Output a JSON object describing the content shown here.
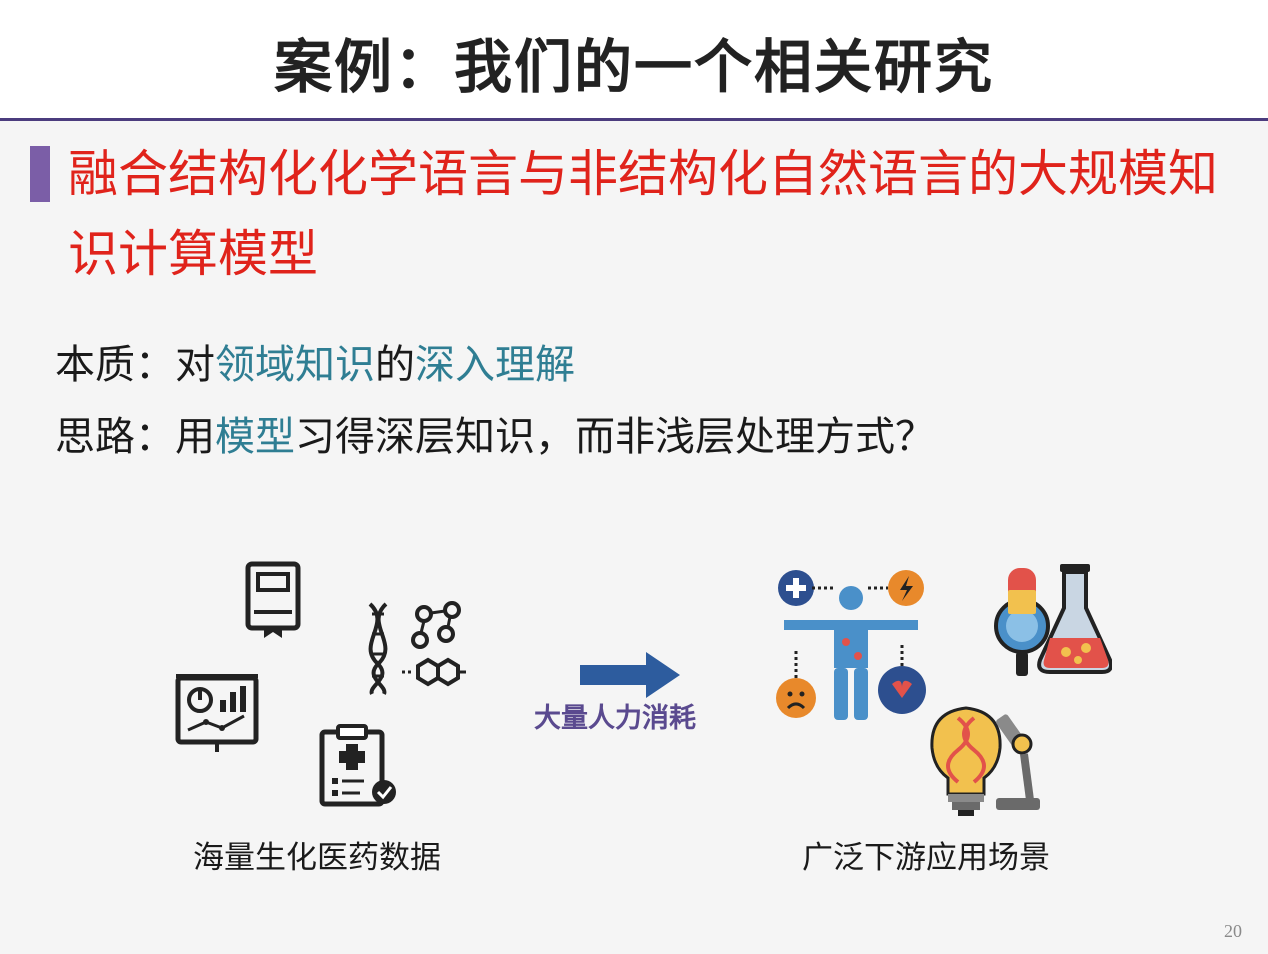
{
  "slide": {
    "title": "案例：我们的一个相关研究",
    "headline": "融合结构化化学语言与非结构化自然语言的大规模知识计算模型",
    "line1": {
      "prefix": "本质：对",
      "hl1": "领域知识",
      "mid": "的",
      "hl2": "深入理解"
    },
    "line2": {
      "prefix": "思路：用",
      "hl1": "模型",
      "rest": "习得深层知识，而非浅层处理方式？"
    },
    "left_caption": "海量生化医药数据",
    "arrow_label": "大量人力消耗",
    "right_caption": "广泛下游应用场景",
    "page_number": "20"
  },
  "colors": {
    "title_rule": "#4b3c7e",
    "accent_bar": "#7b5ea7",
    "headline": "#e0231b",
    "highlight": "#2f7e93",
    "arrow": "#2d5c9e"
  },
  "icons": [
    "book-icon",
    "dna-molecule-icon",
    "dashboard-chart-icon",
    "medical-clipboard-icon",
    "arrow-right-icon",
    "human-body-health-icon",
    "lab-flask-magnifier-icon",
    "dna-bulb-microscope-icon"
  ]
}
